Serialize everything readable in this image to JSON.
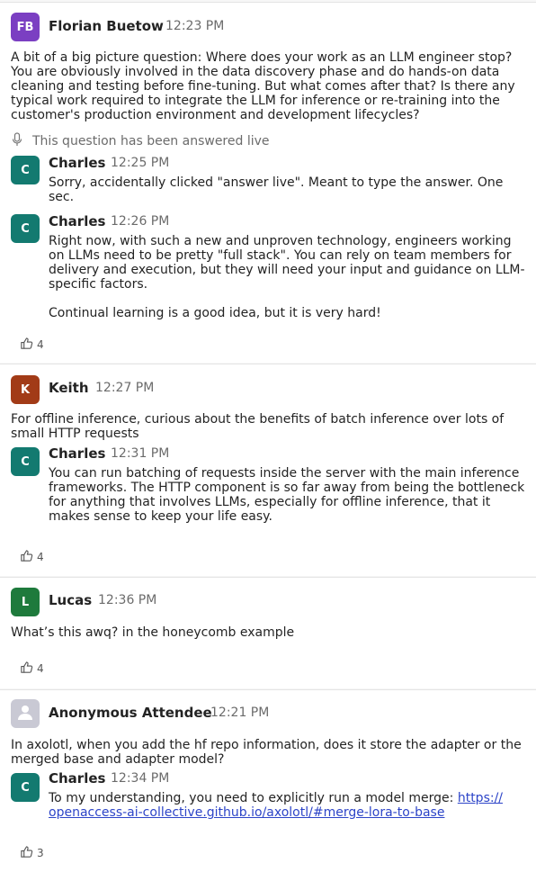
{
  "colors": {
    "avatar_fb": "#7b3fc2",
    "avatar_c": "#137a70",
    "avatar_k": "#a23b17",
    "avatar_l": "#1e7a3c",
    "avatar_anon": "#c9c9d4",
    "link": "#2c44c8"
  },
  "posts": [
    {
      "author": {
        "initials": "FB",
        "name": "Florian Buetow",
        "time": "12:23 PM"
      },
      "question": "A bit of a big picture question: Where does your work as an LLM engineer stop? You are obviously involved in the data discovery phase and do hands-on data cleaning and testing before fine-tuning. But what comes after that? Is there any typical work required to integrate the LLM for inference or re-training into the customer's production environment and development lifecycles?",
      "status": {
        "icon": "microphone-icon",
        "text": "This question has been answered live"
      },
      "replies": [
        {
          "initials": "C",
          "name": "Charles",
          "time": "12:25 PM",
          "text": "Sorry, accidentally clicked \"answer live\". Meant to type the answer. One sec."
        },
        {
          "initials": "C",
          "name": "Charles",
          "time": "12:26 PM",
          "text": "Right now, with such a new and unproven technology, engineers working on LLMs need to be pretty \"full stack\". You can rely on team members for delivery and execution, but they will need your input and guidance on LLM-specific factors.",
          "text2": "Continual learning is a good idea, but it is very hard!"
        }
      ],
      "likes": "4"
    },
    {
      "author": {
        "initials": "K",
        "name": "Keith",
        "time": "12:27 PM"
      },
      "question": "For offline inference, curious about the benefits of batch inference over lots of small HTTP requests",
      "replies": [
        {
          "initials": "C",
          "name": "Charles",
          "time": "12:31 PM",
          "text": "You can run batching of requests inside the server with the main inference frameworks. The HTTP component is so far away from being the bottleneck for anything that involves LLMs, especially for offline inference, that it makes sense to keep your life easy."
        }
      ],
      "likes": "4"
    },
    {
      "author": {
        "initials": "L",
        "name": "Lucas",
        "time": "12:36 PM"
      },
      "question": "What’s this awq? in the honeycomb example",
      "likes": "4"
    },
    {
      "author": {
        "initials": "",
        "name": "Anonymous Attendee",
        "time": "12:21 PM",
        "icon": "user-silhouette-icon"
      },
      "question": "In axolotl, when you add the hf repo information, does it store the adapter or the merged base and adapter model?",
      "replies": [
        {
          "initials": "C",
          "name": "Charles",
          "time": "12:34 PM",
          "text": "To my understanding, you need to explicitly run a model merge: ",
          "link": "https://\nopenaccess-ai-collective.github.io/axolotl/#merge-lora-to-base"
        }
      ],
      "likes": "3"
    }
  ]
}
